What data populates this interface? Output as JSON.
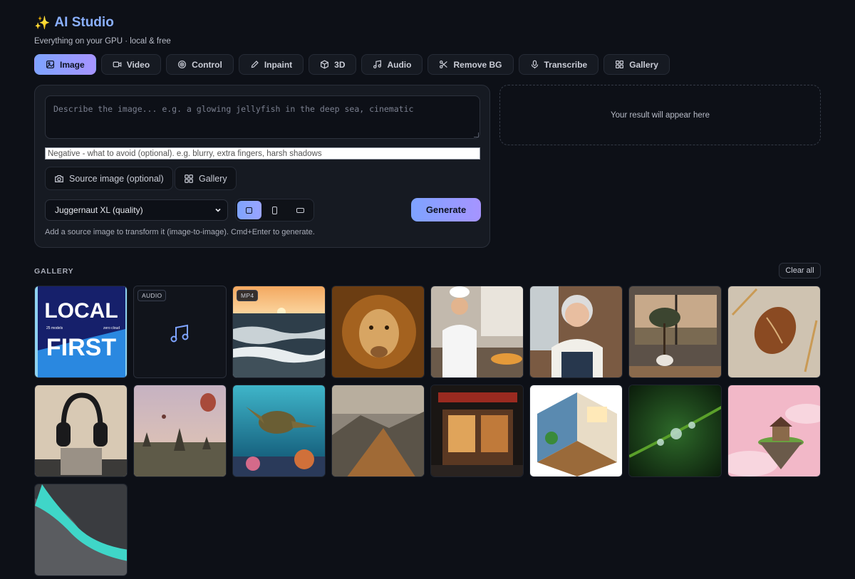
{
  "app": {
    "title": "AI Studio",
    "subtitle": "Everything on your GPU · local & free",
    "title_icon": "sparkles-icon"
  },
  "tabs": [
    {
      "label": "Image",
      "icon": "image-icon",
      "active": true
    },
    {
      "label": "Video",
      "icon": "video-icon",
      "active": false
    },
    {
      "label": "Control",
      "icon": "target-icon",
      "active": false
    },
    {
      "label": "Inpaint",
      "icon": "brush-icon",
      "active": false
    },
    {
      "label": "3D",
      "icon": "cube-icon",
      "active": false
    },
    {
      "label": "Audio",
      "icon": "music-icon",
      "active": false
    },
    {
      "label": "Remove BG",
      "icon": "scissors-icon",
      "active": false
    },
    {
      "label": "Transcribe",
      "icon": "microphone-icon",
      "active": false
    },
    {
      "label": "Gallery",
      "icon": "grid-icon",
      "active": false
    }
  ],
  "form": {
    "prompt_placeholder": "Describe the image... e.g. a glowing jellyfish in the deep sea, cinematic",
    "negative_placeholder": "Negative - what to avoid (optional). e.g. blurry, extra fingers, harsh shadows",
    "source_image_label": "Source image (optional)",
    "gallery_label": "Gallery",
    "model_selected": "Juggernaut XL (quality)",
    "aspect_ratios": [
      "square",
      "portrait",
      "landscape"
    ],
    "aspect_selected": "square",
    "generate_label": "Generate",
    "hint": "Add a source image to transform it (image-to-image). Cmd+Enter to generate."
  },
  "result": {
    "placeholder": "Your result will appear here"
  },
  "gallery": {
    "heading": "GALLERY",
    "clear_label": "Clear all",
    "items": [
      {
        "kind": "image",
        "subject": "local-first-poster",
        "poster_top": "LOCAL",
        "poster_bottom": "FIRST",
        "poster_small_left": "25 models",
        "poster_small_right": "zero cloud"
      },
      {
        "kind": "audio",
        "badge": "AUDIO",
        "subject": "music-icon"
      },
      {
        "kind": "video",
        "badge": "MP4",
        "subject": "ocean-sunset"
      },
      {
        "kind": "image",
        "subject": "lion"
      },
      {
        "kind": "image",
        "subject": "chef-kitchen"
      },
      {
        "kind": "image",
        "subject": "grandmother-kitchen"
      },
      {
        "kind": "image",
        "subject": "olive-tree-window"
      },
      {
        "kind": "image",
        "subject": "bread-wheat"
      },
      {
        "kind": "image",
        "subject": "headphones"
      },
      {
        "kind": "image",
        "subject": "balloons-temples"
      },
      {
        "kind": "image",
        "subject": "sea-turtle"
      },
      {
        "kind": "image",
        "subject": "mountain-ridge"
      },
      {
        "kind": "image",
        "subject": "night-storefront"
      },
      {
        "kind": "image",
        "subject": "isometric-room"
      },
      {
        "kind": "image",
        "subject": "dewdrops-stem"
      },
      {
        "kind": "image",
        "subject": "floating-island"
      },
      {
        "kind": "image",
        "subject": "aerial-river"
      }
    ]
  },
  "colors": {
    "background": "#0d1017",
    "panel": "#161a22",
    "accent_start": "#7ea3ff",
    "accent_end": "#a694ff",
    "title": "#8ab0ff"
  }
}
